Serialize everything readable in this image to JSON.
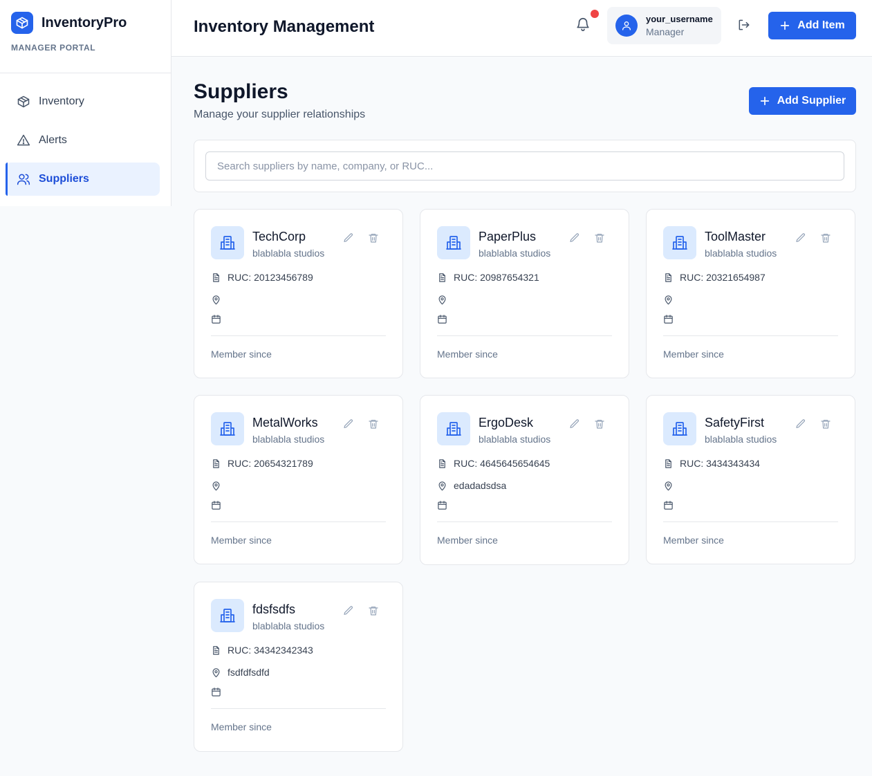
{
  "brand": {
    "name": "InventoryPro",
    "subtitle": "MANAGER PORTAL",
    "accent": "#2563eb"
  },
  "sidebar": {
    "items": [
      {
        "label": "Inventory",
        "icon": "package-icon",
        "active": false
      },
      {
        "label": "Alerts",
        "icon": "alert-triangle-icon",
        "active": false
      },
      {
        "label": "Suppliers",
        "icon": "users-icon",
        "active": true
      }
    ]
  },
  "header": {
    "title": "Inventory Management",
    "user": {
      "name": "your_username",
      "role": "Manager"
    },
    "add_item_label": "Add Item",
    "notification_dot_color": "#ef4444"
  },
  "page": {
    "title": "Suppliers",
    "subtitle": "Manage your supplier relationships",
    "add_supplier_label": "Add Supplier",
    "search_placeholder": "Search suppliers by name, company, or RUC..."
  },
  "suppliers": [
    {
      "name": "TechCorp",
      "company": "blablabla studios",
      "ruc": "RUC: 20123456789",
      "address": "",
      "member_since": "Member since"
    },
    {
      "name": "PaperPlus",
      "company": "blablabla studios",
      "ruc": "RUC: 20987654321",
      "address": "",
      "member_since": "Member since"
    },
    {
      "name": "ToolMaster",
      "company": "blablabla studios",
      "ruc": "RUC: 20321654987",
      "address": "",
      "member_since": "Member since"
    },
    {
      "name": "MetalWorks",
      "company": "blablabla studios",
      "ruc": "RUC: 20654321789",
      "address": "",
      "member_since": "Member since"
    },
    {
      "name": "ErgoDesk",
      "company": "blablabla studios",
      "ruc": "RUC: 4645645654645",
      "address": "edadadsdsa",
      "member_since": "Member since"
    },
    {
      "name": "SafetyFirst",
      "company": "blablabla studios",
      "ruc": "RUC: 3434343434",
      "address": "",
      "member_since": "Member since"
    },
    {
      "name": "fdsfsdfs",
      "company": "blablabla studios",
      "ruc": "RUC: 34342342343",
      "address": "fsdfdfsdfd",
      "member_since": "Member since"
    }
  ]
}
